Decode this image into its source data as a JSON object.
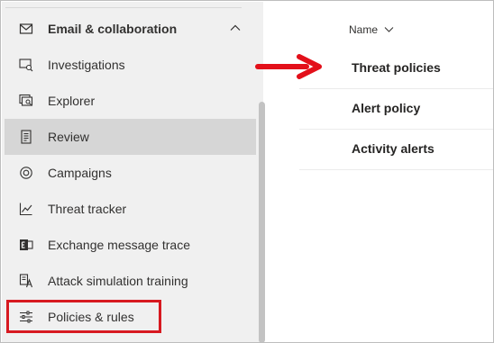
{
  "sidebar": {
    "section": {
      "label": "Email & collaboration",
      "icon": "mail-icon"
    },
    "items": [
      {
        "label": "Investigations",
        "icon": "investigations-icon"
      },
      {
        "label": "Explorer",
        "icon": "explorer-icon"
      },
      {
        "label": "Review",
        "icon": "review-icon",
        "selected": true
      },
      {
        "label": "Campaigns",
        "icon": "campaigns-icon"
      },
      {
        "label": "Threat tracker",
        "icon": "chart-icon"
      },
      {
        "label": "Exchange message trace",
        "icon": "exchange-icon"
      },
      {
        "label": "Attack simulation training",
        "icon": "attack-simulation-icon"
      },
      {
        "label": "Policies & rules",
        "icon": "sliders-icon",
        "highlighted": true
      }
    ]
  },
  "table": {
    "column_header": "Name",
    "rows": [
      {
        "name": "Threat policies"
      },
      {
        "name": "Alert policy"
      },
      {
        "name": "Activity alerts"
      }
    ]
  },
  "colors": {
    "sidebar_bg": "#f0f0f0",
    "selected_bg": "#d6d6d6",
    "annotation_red": "#d71920"
  }
}
